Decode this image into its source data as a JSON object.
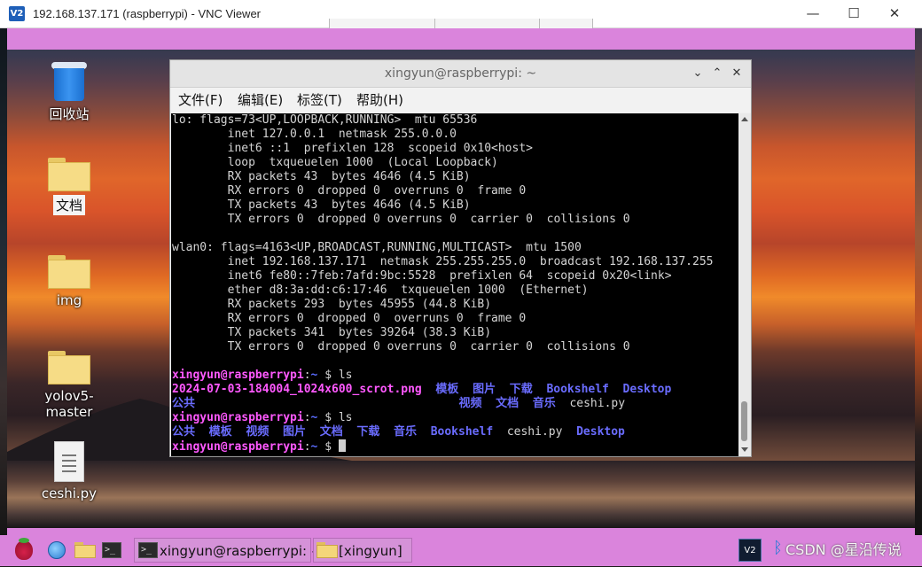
{
  "vnc": {
    "title": "192.168.137.171 (raspberrypi) - VNC Viewer",
    "logo": "V2",
    "controls": {
      "minimize": "—",
      "maximize": "☐",
      "close": "✕"
    }
  },
  "desktop": {
    "icons": [
      {
        "label": "回收站",
        "icon": "trash-icon"
      },
      {
        "label": "文档",
        "icon": "folder-icon",
        "selected": true
      },
      {
        "label": "img",
        "icon": "folder-icon"
      },
      {
        "label": "yolov5-master",
        "icon": "folder-icon"
      },
      {
        "label": "ceshi.py",
        "icon": "file-icon"
      }
    ]
  },
  "terminal": {
    "title": "xingyun@raspberrypi: ~",
    "controls": {
      "minimize": "⌄",
      "maximize": "⌃",
      "close": "✕"
    },
    "menu": [
      "文件(F)",
      "编辑(E)",
      "标签(T)",
      "帮助(H)"
    ],
    "output": [
      "lo: flags=73<UP,LOOPBACK,RUNNING>  mtu 65536",
      "        inet 127.0.0.1  netmask 255.0.0.0",
      "        inet6 ::1  prefixlen 128  scopeid 0x10<host>",
      "        loop  txqueuelen 1000  (Local Loopback)",
      "        RX packets 43  bytes 4646 (4.5 KiB)",
      "        RX errors 0  dropped 0  overruns 0  frame 0",
      "        TX packets 43  bytes 4646 (4.5 KiB)",
      "        TX errors 0  dropped 0 overruns 0  carrier 0  collisions 0",
      "",
      "wlan0: flags=4163<UP,BROADCAST,RUNNING,MULTICAST>  mtu 1500",
      "        inet 192.168.137.171  netmask 255.255.255.0  broadcast 192.168.137.255",
      "        inet6 fe80::7feb:7afd:9bc:5528  prefixlen 64  scopeid 0x20<link>",
      "        ether d8:3a:dd:c6:17:46  txqueuelen 1000  (Ethernet)",
      "        RX packets 293  bytes 45955 (44.8 KiB)",
      "        RX errors 0  dropped 0  overruns 0  frame 0",
      "        TX packets 341  bytes 39264 (38.3 KiB)",
      "        TX errors 0  dropped 0 overruns 0  carrier 0  collisions 0",
      ""
    ],
    "prompt_user": "xingyun@raspberrypi",
    "prompt_sep": ":",
    "prompt_path": "~",
    "prompt_dollar": " $ ",
    "cmd": "ls",
    "ls1_row1": [
      {
        "text": "2024-07-03-184004_1024x600_scrot.png",
        "kind": "pink"
      },
      {
        "text": "模板",
        "kind": "blue"
      },
      {
        "text": "图片",
        "kind": "blue"
      },
      {
        "text": "下载",
        "kind": "blue"
      },
      {
        "text": "Bookshelf",
        "kind": "blue"
      },
      {
        "text": "Desktop",
        "kind": "blue"
      }
    ],
    "ls1_row2": [
      {
        "text": "公共",
        "kind": "blue"
      },
      {
        "text": "视频",
        "kind": "blue"
      },
      {
        "text": "文档",
        "kind": "blue"
      },
      {
        "text": "音乐",
        "kind": "blue"
      },
      {
        "text": "ceshi.py",
        "kind": "white"
      }
    ],
    "ls2_row": [
      {
        "text": "公共",
        "kind": "blue"
      },
      {
        "text": "模板",
        "kind": "blue"
      },
      {
        "text": "视频",
        "kind": "blue"
      },
      {
        "text": "图片",
        "kind": "blue"
      },
      {
        "text": "文档",
        "kind": "blue"
      },
      {
        "text": "下载",
        "kind": "blue"
      },
      {
        "text": "音乐",
        "kind": "blue"
      },
      {
        "text": "Bookshelf",
        "kind": "blue"
      },
      {
        "text": "ceshi.py",
        "kind": "white"
      },
      {
        "text": "Desktop",
        "kind": "blue"
      }
    ],
    "colors": {
      "pink": "#ff59ff",
      "blue": "#6a6cff",
      "text": "#d4d4d4",
      "background": "#000000"
    }
  },
  "taskbar": {
    "launchers": [
      "raspberry-menu-icon",
      "browser-globe-icon",
      "file-manager-icon",
      "terminal-icon"
    ],
    "tasks": [
      {
        "label": "xingyun@raspberrypi: ~",
        "icon": "terminal-icon"
      },
      {
        "label": "[xingyun]",
        "icon": "folder-icon"
      }
    ],
    "tray_vnc": "V2",
    "tray_bluetooth": "bluetooth-icon",
    "watermark": "CSDN @星沿传说",
    "background": "#da84dc"
  }
}
